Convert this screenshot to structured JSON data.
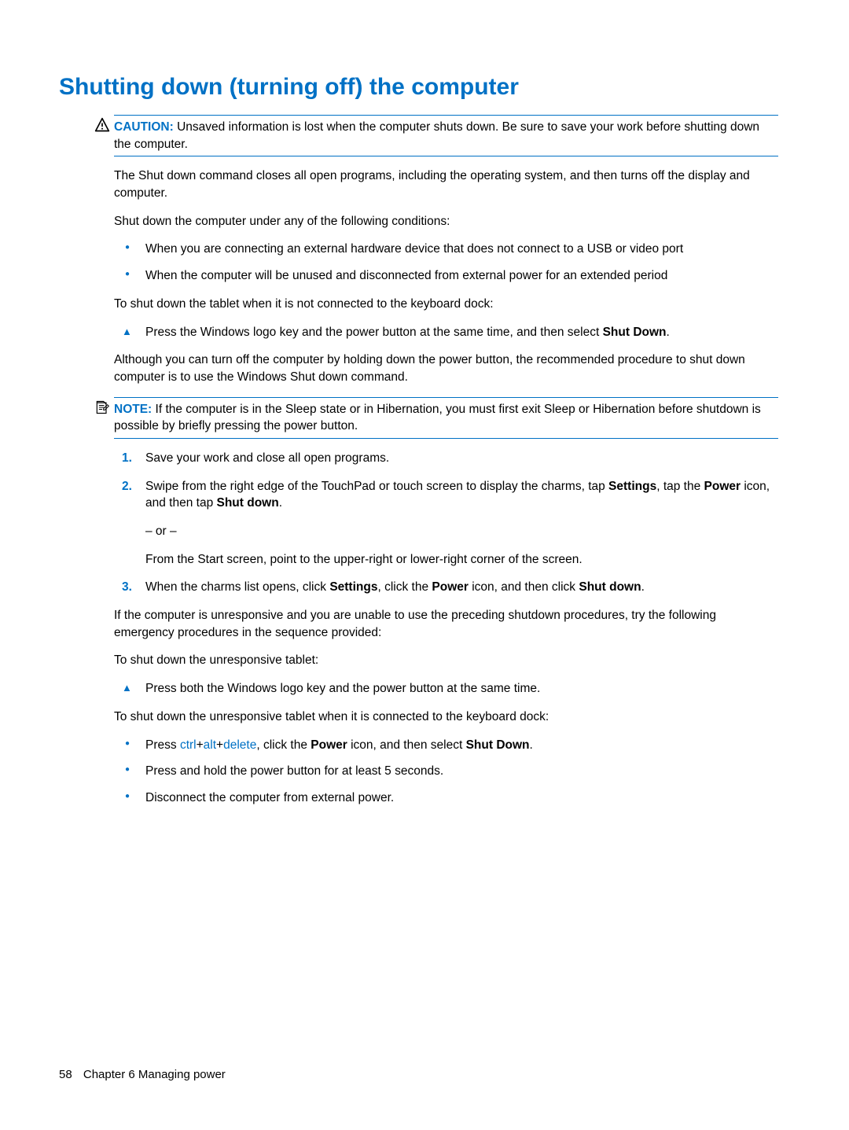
{
  "heading": "Shutting down (turning off) the computer",
  "caution": {
    "label": "CAUTION:",
    "text": "Unsaved information is lost when the computer shuts down. Be sure to save your work before shutting down the computer."
  },
  "p1": "The Shut down command closes all open programs, including the operating system, and then turns off the display and computer.",
  "p2": "Shut down the computer under any of the following conditions:",
  "bullets1": {
    "b1": "When you are connecting an external hardware device that does not connect to a USB or video port",
    "b2": "When the computer will be unused and disconnected from external power for an extended period"
  },
  "p3": "To shut down the tablet when it is not connected to the keyboard dock:",
  "tri1": {
    "pre": "Press the Windows logo key and the power button at the same time, and then select ",
    "bold1": "Shut Down",
    "post": "."
  },
  "p4": "Although you can turn off the computer by holding down the power button, the recommended procedure to shut down computer is to use the Windows Shut down command.",
  "note": {
    "label": "NOTE:",
    "text": "If the computer is in the Sleep state or in Hibernation, you must first exit Sleep or Hibernation before shutdown is possible by briefly pressing the power button."
  },
  "steps": {
    "s1": {
      "text": "Save your work and close all open programs."
    },
    "s2": {
      "pre": "Swipe from the right edge of the TouchPad or touch screen to display the charms, tap ",
      "bold1": "Settings",
      "mid1": ", tap the ",
      "bold2": "Power",
      "mid2": " icon, and then tap ",
      "bold3": "Shut down",
      "post": ".",
      "or": "– or –",
      "alt": "From the Start screen, point to the upper-right or lower-right corner of the screen."
    },
    "s3": {
      "pre": "When the charms list opens, click ",
      "bold1": "Settings",
      "mid1": ", click the ",
      "bold2": "Power",
      "mid2": " icon, and then click ",
      "bold3": "Shut down",
      "post": "."
    }
  },
  "p5": "If the computer is unresponsive and you are unable to use the preceding shutdown procedures, try the following emergency procedures in the sequence provided:",
  "p6": "To shut down the unresponsive tablet:",
  "tri2": "Press both the Windows logo key and the power button at the same time.",
  "p7": "To shut down the unresponsive tablet when it is connected to the keyboard dock:",
  "bullets2": {
    "b1": {
      "pre": "Press ",
      "k1": "ctrl",
      "plus1": "+",
      "k2": "alt",
      "plus2": "+",
      "k3": "delete",
      "mid1": ", click the ",
      "bold1": "Power",
      "mid2": " icon, and then select ",
      "bold2": "Shut Down",
      "post": "."
    },
    "b2": "Press and hold the power button for at least 5 seconds.",
    "b3": "Disconnect the computer from external power."
  },
  "footer": {
    "page": "58",
    "chapter": "Chapter 6   Managing power"
  }
}
